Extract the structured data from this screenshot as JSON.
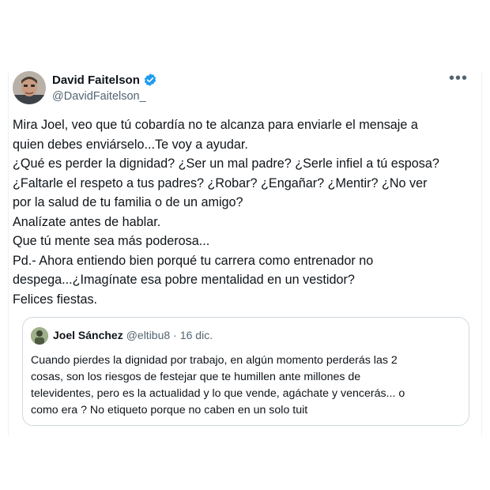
{
  "tweet": {
    "author_name": "David Faitelson",
    "author_handle": "@DavidFaitelson_",
    "body_lines": [
      "Mira Joel, veo que tú cobardía no te alcanza para enviarle el mensaje a",
      "quien debes enviárselo...Te voy a ayudar.",
      "¿Qué es perder la dignidad? ¿Ser un mal padre? ¿Serle infiel a tú esposa?",
      "¿Faltarle el respeto a tus padres? ¿Robar? ¿Engañar? ¿Mentir? ¿No ver",
      "por la salud de tu familia o de un amigo?",
      "Analízate antes de hablar.",
      "Que tú mente sea más poderosa...",
      "Pd.- Ahora entiendo bien porqué tu carrera como entrenador no",
      "despega...¿Imagínate esa pobre mentalidad en un vestidor?",
      "Felices fiestas."
    ]
  },
  "quoted": {
    "author_name": "Joel Sánchez",
    "author_handle": "@eltibu8",
    "separator": "·",
    "date": "16 dic.",
    "body_lines": [
      "Cuando pierdes la dignidad por trabajo, en algún momento perderás las 2",
      "cosas, son los riesgos de festejar que te humillen ante millones de",
      "televidentes, pero es la actualidad y lo que vende, agáchate y vencerás... o",
      "como era ? No etiqueto porque no caben en un solo tuit"
    ]
  },
  "icons": {
    "more": "more-horizontal-icon",
    "verified": "verified-badge-icon"
  },
  "colors": {
    "verified": "#1d9bf0",
    "secondary_text": "#536471",
    "border": "#cfd9de"
  }
}
